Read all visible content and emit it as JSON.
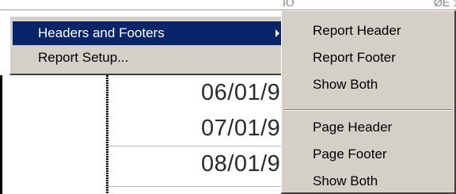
{
  "background": {
    "top_fragments": [
      "IO",
      "ØE 1"
    ],
    "date_cells": [
      "06/01/9",
      "07/01/9",
      "08/01/9"
    ]
  },
  "main_menu": {
    "items": [
      {
        "label": "Headers and Footers",
        "has_submenu": true,
        "highlighted": true
      },
      {
        "label": "Report Setup...",
        "has_submenu": false,
        "highlighted": false
      }
    ]
  },
  "submenu": {
    "items": [
      {
        "label": "Report Header"
      },
      {
        "label": "Report Footer"
      },
      {
        "label": "Show Both"
      },
      {
        "label": "Page Header"
      },
      {
        "label": "Page Footer"
      },
      {
        "label": "Show Both"
      }
    ]
  },
  "colors": {
    "menu_background": "#d4d0c8",
    "highlight_background": "#0a246a",
    "highlight_text": "#ffffff"
  },
  "icons": {
    "submenu_arrow": "triangle-right-icon"
  }
}
